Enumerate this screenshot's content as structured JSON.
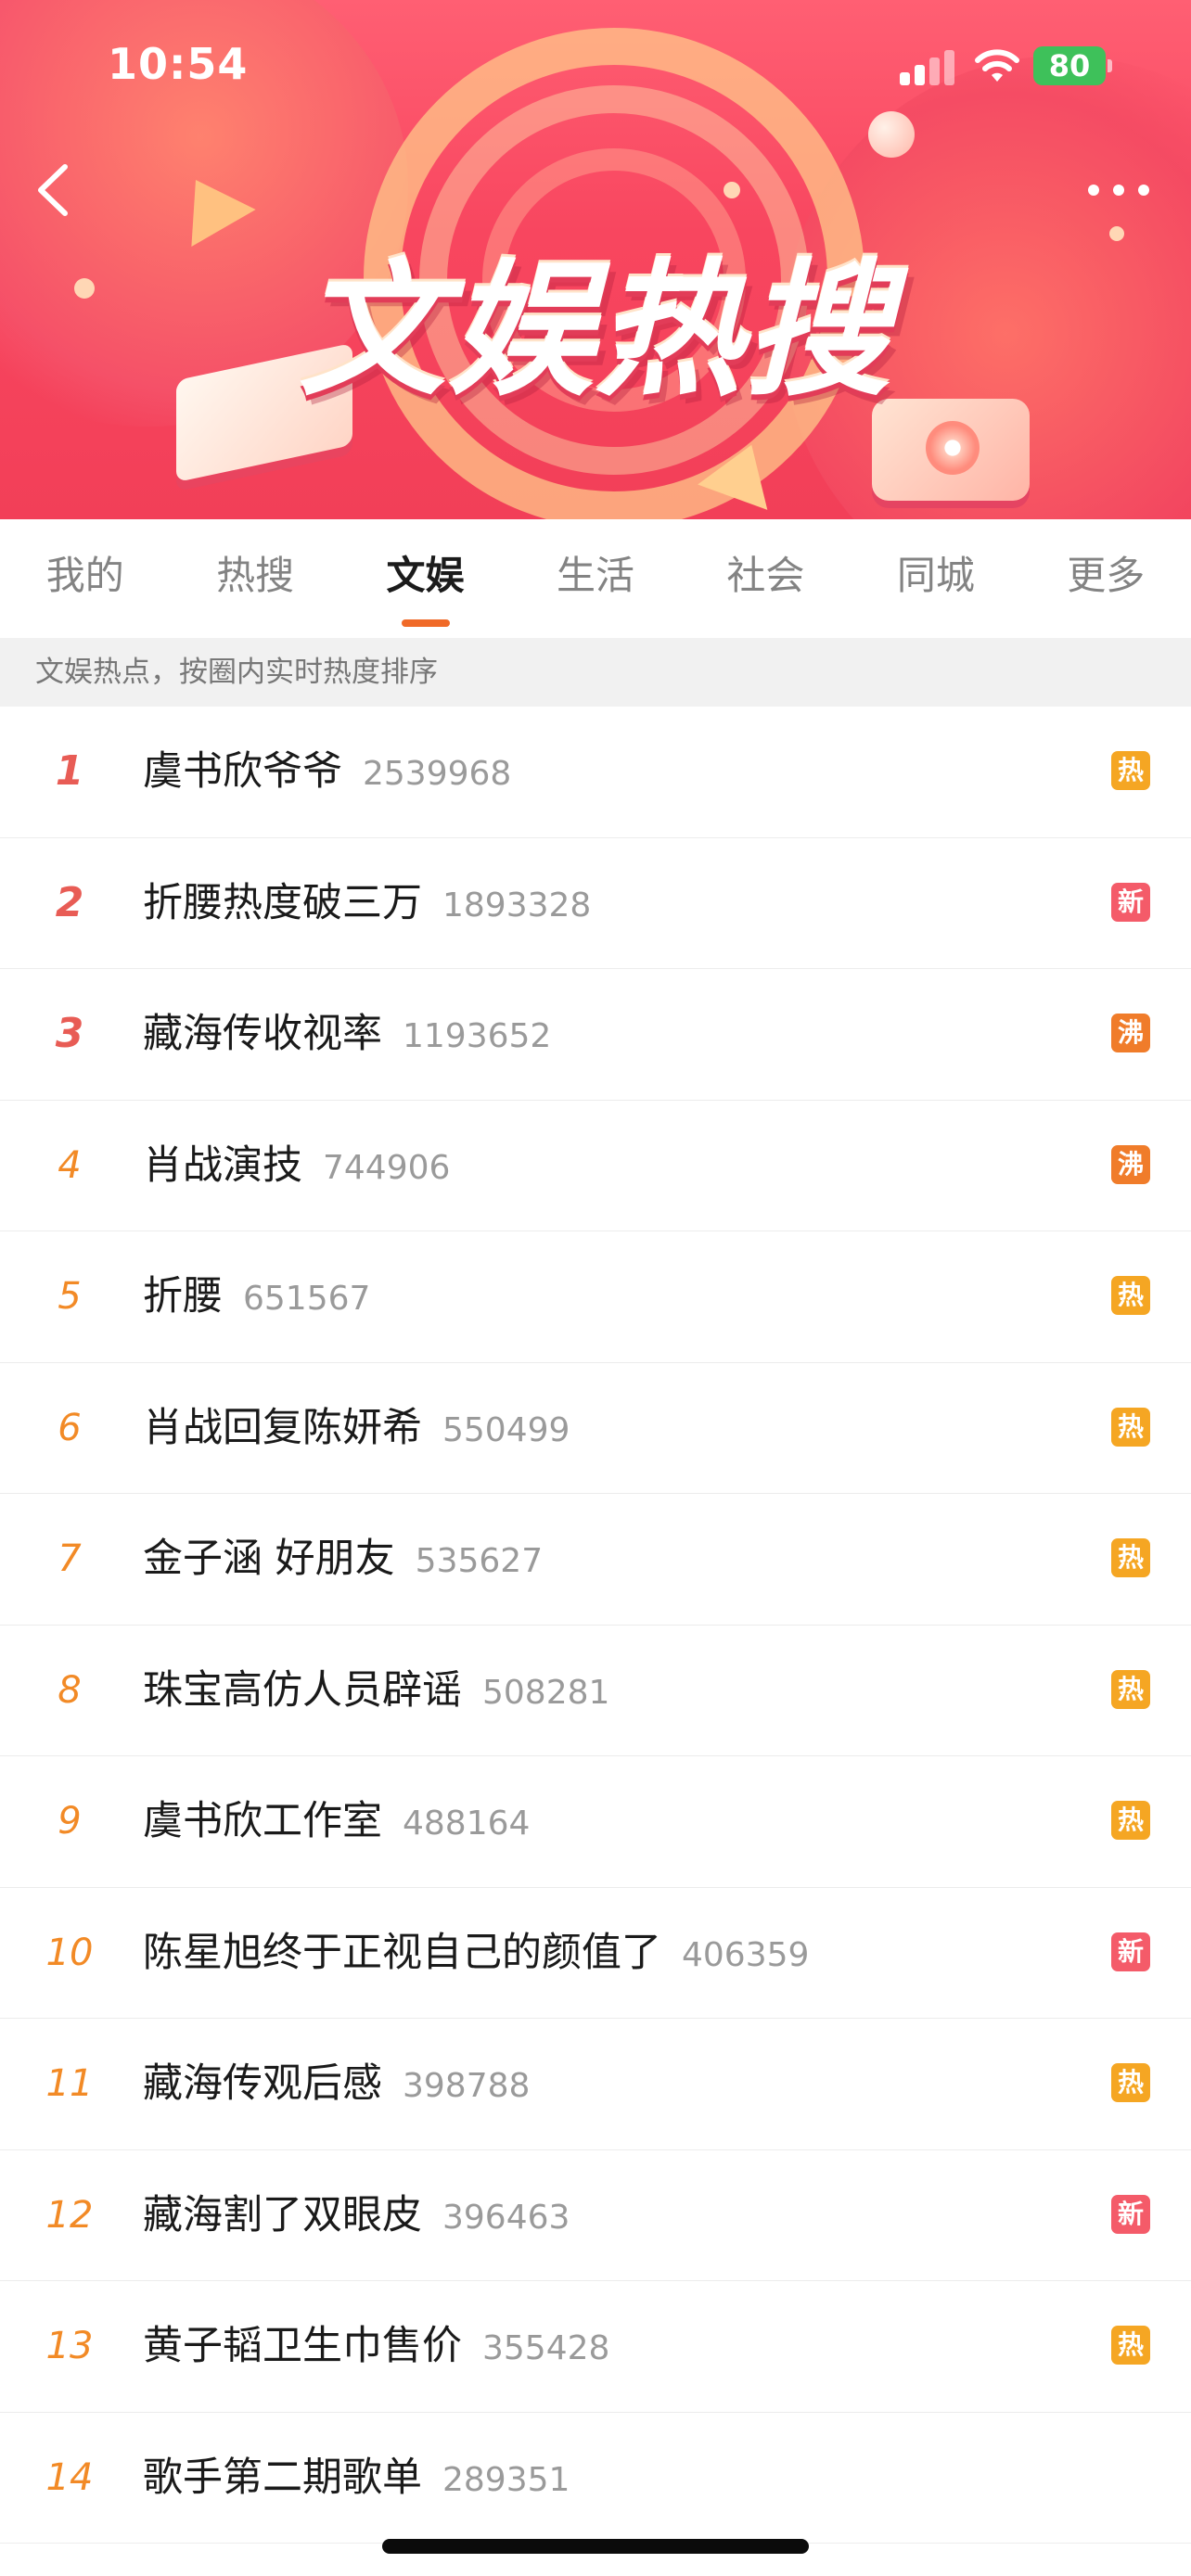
{
  "status_bar": {
    "time": "10:54",
    "battery": "80"
  },
  "banner": {
    "title": "文娱热搜"
  },
  "tabs": [
    {
      "label": "我的"
    },
    {
      "label": "热搜"
    },
    {
      "label": "文娱"
    },
    {
      "label": "生活"
    },
    {
      "label": "社会"
    },
    {
      "label": "同城"
    },
    {
      "label": "更多"
    }
  ],
  "active_tab": "文娱",
  "subheader": "文娱热点，按圈内实时热度排序",
  "list": [
    {
      "rank": "1",
      "title": "虞书欣爷爷",
      "count": "2539968",
      "badge": "热",
      "badge_color": "#f5a623"
    },
    {
      "rank": "2",
      "title": "折腰热度破三万",
      "count": "1893328",
      "badge": "新",
      "badge_color": "#f45b69"
    },
    {
      "rank": "3",
      "title": "藏海传收视率",
      "count": "1193652",
      "badge": "沸",
      "badge_color": "#f07c2a"
    },
    {
      "rank": "4",
      "title": "肖战演技",
      "count": "744906",
      "badge": "沸",
      "badge_color": "#f07c2a"
    },
    {
      "rank": "5",
      "title": "折腰",
      "count": "651567",
      "badge": "热",
      "badge_color": "#f5a623"
    },
    {
      "rank": "6",
      "title": "肖战回复陈妍希",
      "count": "550499",
      "badge": "热",
      "badge_color": "#f5a623"
    },
    {
      "rank": "7",
      "title": "金子涵 好朋友",
      "count": "535627",
      "badge": "热",
      "badge_color": "#f5a623"
    },
    {
      "rank": "8",
      "title": "珠宝高仿人员辟谣",
      "count": "508281",
      "badge": "热",
      "badge_color": "#f5a623"
    },
    {
      "rank": "9",
      "title": "虞书欣工作室",
      "count": "488164",
      "badge": "热",
      "badge_color": "#f5a623"
    },
    {
      "rank": "10",
      "title": "陈星旭终于正视自己的颜值了",
      "count": "406359",
      "badge": "新",
      "badge_color": "#f45b69"
    },
    {
      "rank": "11",
      "title": "藏海传观后感",
      "count": "398788",
      "badge": "热",
      "badge_color": "#f5a623"
    },
    {
      "rank": "12",
      "title": "藏海割了双眼皮",
      "count": "396463",
      "badge": "新",
      "badge_color": "#f45b69"
    },
    {
      "rank": "13",
      "title": "黄子韬卫生巾售价",
      "count": "355428",
      "badge": "热",
      "badge_color": "#f5a623"
    },
    {
      "rank": "14",
      "title": "歌手第二期歌单",
      "count": "289351",
      "badge": "",
      "badge_color": ""
    }
  ]
}
